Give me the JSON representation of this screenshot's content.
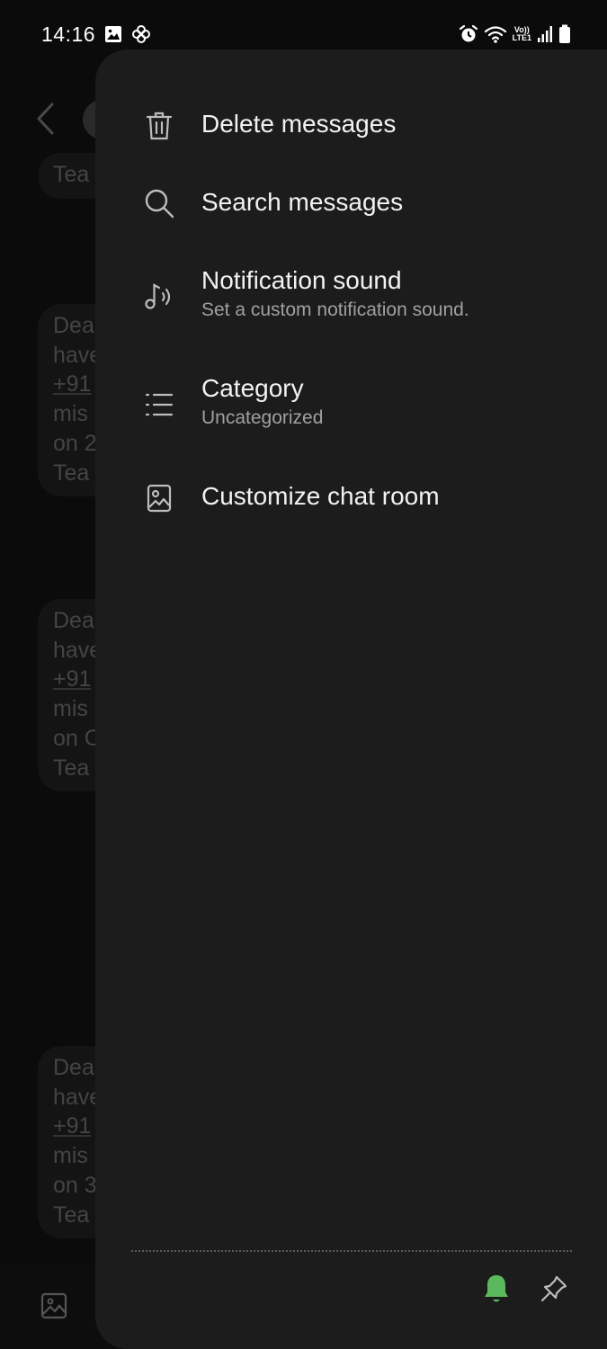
{
  "status_bar": {
    "time": "14:16",
    "volte_label": "Vo))",
    "lte_label": "LTE1"
  },
  "background_chat": {
    "header_partial_text": "Tea",
    "bubbles": [
      {
        "lines": [
          "Dea",
          "have",
          "+91",
          "mis",
          "on 2",
          "Tea"
        ]
      },
      {
        "lines": [
          "Dea",
          "have",
          "+91",
          "mis",
          "on C",
          "Tea"
        ]
      },
      {
        "lines": [
          "Dea",
          "have",
          "+91",
          "mis",
          "on 3",
          "Tea"
        ]
      }
    ]
  },
  "menu": {
    "items": [
      {
        "id": "delete",
        "label": "Delete messages",
        "icon": "trash-icon"
      },
      {
        "id": "search",
        "label": "Search messages",
        "icon": "search-icon"
      },
      {
        "id": "notification",
        "label": "Notification sound",
        "sub": "Set a custom notification sound.",
        "icon": "music-note-icon"
      },
      {
        "id": "category",
        "label": "Category",
        "sub": "Uncategorized",
        "icon": "list-icon"
      },
      {
        "id": "customize",
        "label": "Customize chat room",
        "icon": "image-icon"
      }
    ]
  },
  "bottom_actions": {
    "notification_icon": "bell-icon",
    "pin_icon": "pin-icon",
    "notification_color": "#5cb85c"
  },
  "colors": {
    "drawer_bg": "#1c1c1c",
    "bell_active": "#5cb85c"
  }
}
